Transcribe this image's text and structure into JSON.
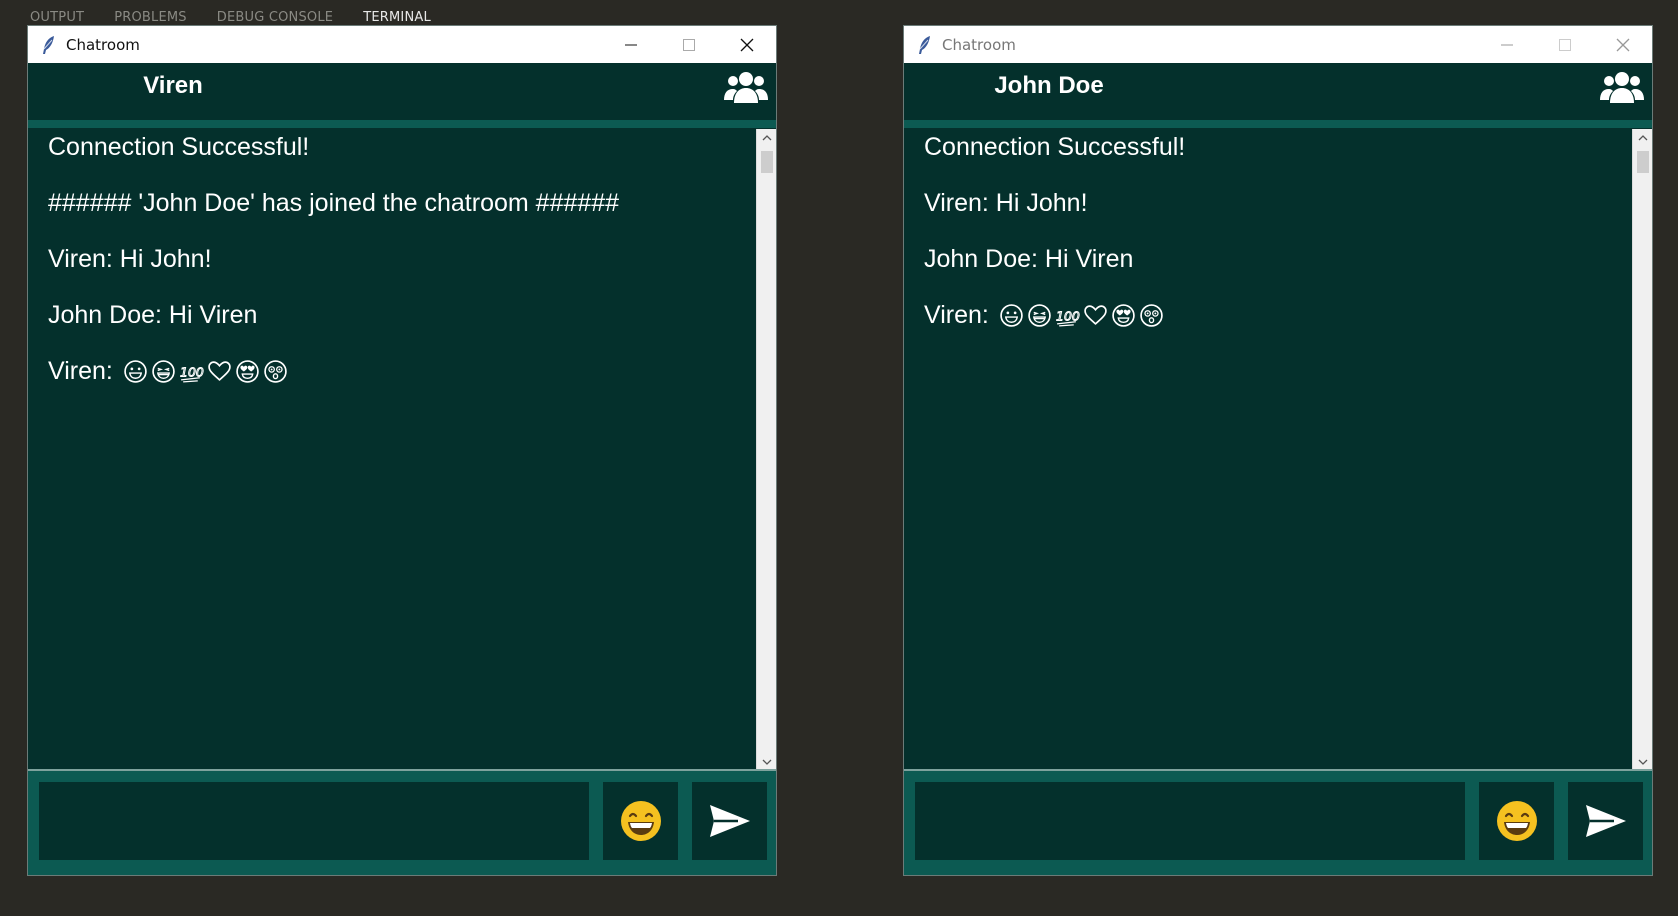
{
  "panel_tabs": [
    "OUTPUT",
    "PROBLEMS",
    "DEBUG CONSOLE",
    "TERMINAL"
  ],
  "active_tab": "TERMINAL",
  "windows": [
    {
      "title": "Chatroom",
      "username": "Viren",
      "messages": [
        "Connection Successful!",
        "###### 'John Doe' has joined the chatroom ######",
        "Viren: Hi John!",
        "John Doe: Hi Viren",
        "Viren:"
      ]
    },
    {
      "title": "Chatroom",
      "username": "John Doe",
      "messages": [
        "Connection Successful!",
        "Viren: Hi John!",
        "John Doe: Hi Viren",
        "Viren:"
      ]
    }
  ],
  "emoji_icons": [
    "grinning-face",
    "grinning-squinting-face",
    "hundred-points",
    "heart",
    "heart-eyes-face",
    "astonished-face"
  ],
  "colors": {
    "bg_dark": "#04302c",
    "accent": "#0c5a52",
    "desktop": "#2a2924",
    "emoji_yellow": "#f5c120"
  }
}
